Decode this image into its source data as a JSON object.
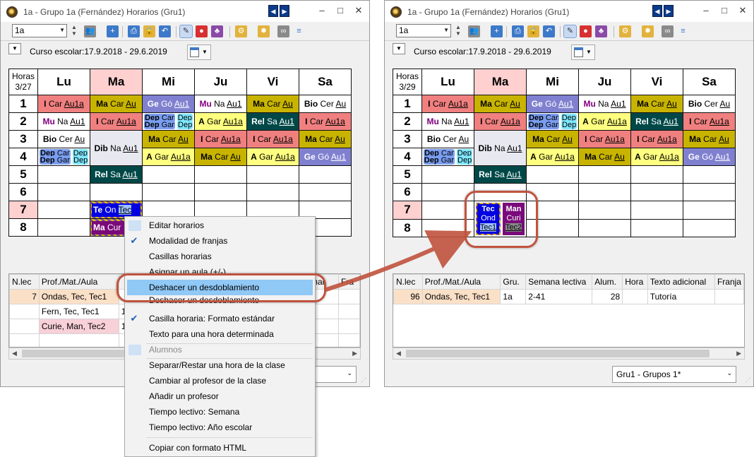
{
  "left_window": {
    "title": "1a - Grupo 1a (Fernández)  Horarios  (Gru1)",
    "class_combo": "1a",
    "course_label": "Curso escolar:17.9.2018 - 29.6.2019",
    "hours_header": "Horas",
    "hours_count": "3/27",
    "days": [
      "Lu",
      "Ma",
      "Mi",
      "Ju",
      "Vi",
      "Sa"
    ],
    "periods": [
      "1",
      "2",
      "3",
      "4",
      "5",
      "6",
      "7",
      "8"
    ],
    "cells": {
      "r1": [
        "I Car Au1a",
        "Ma Car Au",
        "Ge Gó Au1",
        "Mu Na Au1",
        "Ma Car Au",
        "Bio Cer Au"
      ],
      "r2": [
        "Mu Na Au1",
        "I Car Au1a",
        "Dep Car Dep / Dep Gar Dep",
        "A Gar Au1a",
        "Rel Sa Au1",
        "I Car Au1a"
      ],
      "r3": [
        "Bio Cer Au",
        "Dib Na Au1",
        "Ma Car Au",
        "I Car Au1a",
        "Ma Car Au"
      ],
      "r4": [
        "Dep Car Dep / Dep Gar Dep",
        "A Gar Au1a",
        "Ma Car Au",
        "A Gar Au1a",
        "Ge Gó Au1"
      ],
      "r5": [
        "Rel Sa Au1"
      ],
      "r7": [
        "Te On Tec"
      ],
      "r8": [
        "Ma Cur"
      ]
    },
    "lessons_table": {
      "headers": [
        "N.lec",
        "Prof./Mat./Aula",
        "",
        "",
        "",
        "",
        "",
        "nal",
        "Fra"
      ],
      "rows": [
        {
          "nlec": "7",
          "name": "Ondas, Tec, Tec1",
          "g": ""
        },
        {
          "nlec": "",
          "name": "Fern, Tec, Tec1",
          "g": "1"
        },
        {
          "nlec": "",
          "name": "Curie, Man, Tec2",
          "g": "1"
        }
      ]
    }
  },
  "context_menu": {
    "items": [
      {
        "label": "Editar horarios",
        "checked": false,
        "icon": true
      },
      {
        "label": "Modalidad de franjas",
        "checked": true
      },
      {
        "label": "Casillas horarias",
        "checked": false
      },
      {
        "label": "Asignar un aula (+/-)",
        "checked": false
      },
      {
        "label": "Deshacer un desdoblamiento",
        "checked": false,
        "hover": true
      },
      {
        "label": "Deshacer un desdoblamiento",
        "checked": false
      },
      {
        "label": "Casilla horaria: Formato estándar",
        "checked": true
      },
      {
        "label": "Texto para una hora determinada",
        "checked": false
      },
      {
        "label": "Alumnos",
        "checked": false,
        "disabled": true
      },
      {
        "label": "Separar/Restar una hora de la clase",
        "checked": false
      },
      {
        "label": "Cambiar al profesor de la clase",
        "checked": false
      },
      {
        "label": "Añadir un profesor",
        "checked": false
      },
      {
        "label": "Tiempo lectivo: Semana",
        "checked": false
      },
      {
        "label": "Tiempo lectivo: Año escolar",
        "checked": false
      },
      {
        "label": "Copiar con formato HTML",
        "checked": false
      }
    ]
  },
  "right_window": {
    "title": "1a - Grupo 1a (Fernández)  Horarios  (Gru1)",
    "class_combo": "1a",
    "course_label": "Curso escolar:17.9.2018 - 29.6.2019",
    "hours_header": "Horas",
    "hours_count": "3/29",
    "days": [
      "Lu",
      "Ma",
      "Mi",
      "Ju",
      "Vi",
      "Sa"
    ],
    "periods": [
      "1",
      "2",
      "3",
      "4",
      "5",
      "6",
      "7",
      "8"
    ],
    "split_left": [
      "Tec",
      "Ond",
      "Tec1"
    ],
    "split_right": [
      "Man",
      "Curi",
      "Tec2"
    ],
    "lessons_table": {
      "headers": [
        "N.lec",
        "Prof./Mat./Aula",
        "Gru.",
        "Semana lectiva",
        "Alum.",
        "Hora",
        "Texto adicional",
        "Franja"
      ],
      "row": {
        "nlec": "96",
        "name": "Ondas, Tec, Tec1",
        "group": "1a",
        "week": "2-41",
        "students": "28",
        "hour": "",
        "text": "Tutoría",
        "band": ""
      }
    },
    "group_select": "Gru1 - Grupos 1*"
  },
  "colors": {
    "salmon": "#f08080",
    "olive": "#c8b400",
    "yellow": "#ffff80",
    "lavender": "#8080d0",
    "dark_green": "#004848",
    "today": "#ffd0d0",
    "callout": "#c0533e",
    "menu_highlight": "#90c8f6"
  }
}
